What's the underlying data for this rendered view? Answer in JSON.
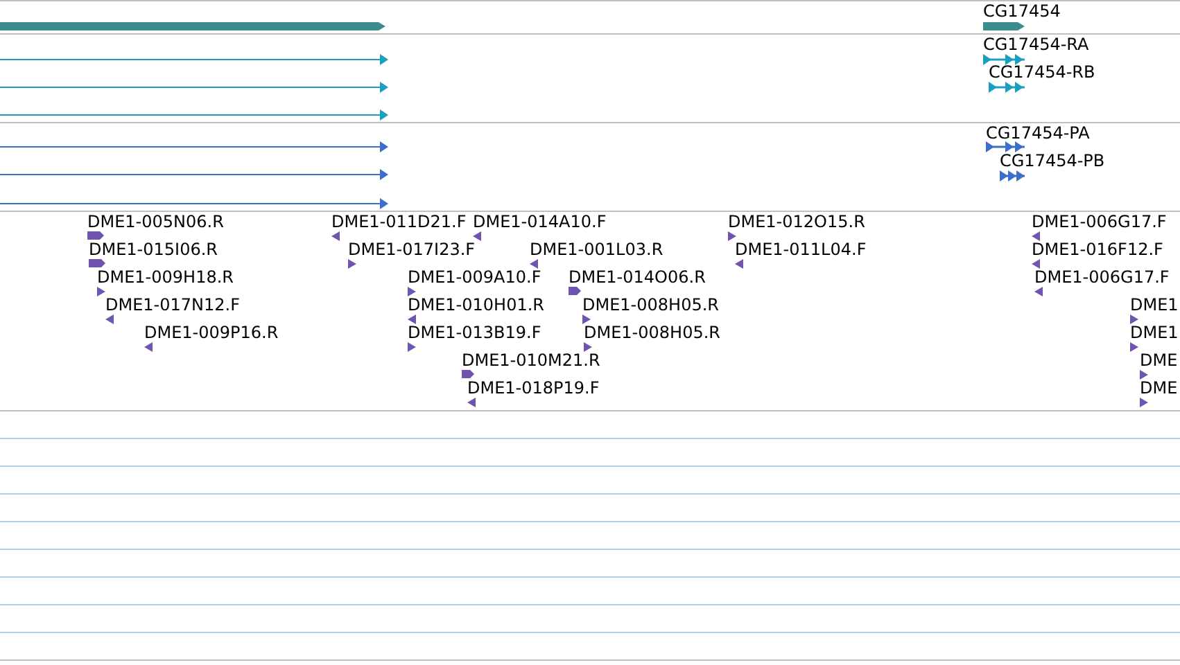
{
  "tracks": [
    {
      "kind": "gene",
      "features": [
        {
          "kind": "span"
        },
        {
          "kind": "model",
          "label": "CG17454"
        }
      ]
    },
    {
      "kind": "transcript",
      "features": [
        {
          "kind": "span"
        },
        {
          "kind": "span"
        },
        {
          "kind": "span"
        },
        {
          "kind": "model",
          "label": "CG17454-RA"
        },
        {
          "kind": "model",
          "label": "CG17454-RB"
        }
      ]
    },
    {
      "kind": "protein",
      "features": [
        {
          "kind": "span"
        },
        {
          "kind": "span"
        },
        {
          "kind": "span"
        },
        {
          "kind": "model",
          "label": "CG17454-PA"
        },
        {
          "kind": "model",
          "label": "CG17454-PB"
        }
      ]
    },
    {
      "kind": "est",
      "features": [
        {
          "label": "DME1-005N06.R",
          "reverse": false
        },
        {
          "label": "DME1-015I06.R",
          "reverse": false
        },
        {
          "label": "DME1-009H18.R",
          "reverse": false
        },
        {
          "label": "DME1-017N12.F",
          "reverse": true
        },
        {
          "label": "DME1-009P16.R",
          "reverse": true
        },
        {
          "label": "DME1-011D21.F",
          "reverse": true
        },
        {
          "label": "DME1-014A10.F",
          "reverse": true
        },
        {
          "label": "DME1-017I23.F",
          "reverse": false
        },
        {
          "label": "DME1-001L03.R",
          "reverse": true
        },
        {
          "label": "DME1-009A10.F",
          "reverse": false
        },
        {
          "label": "DME1-014O06.R",
          "reverse": false
        },
        {
          "label": "DME1-010H01.R",
          "reverse": true
        },
        {
          "label": "DME1-008H05.R",
          "reverse": false
        },
        {
          "label": "DME1-013B19.F",
          "reverse": false
        },
        {
          "label": "DME1-008H05.R",
          "reverse": false
        },
        {
          "label": "DME1-010M21.R",
          "reverse": false
        },
        {
          "label": "DME1-018P19.F",
          "reverse": true
        },
        {
          "label": "DME1-012O15.R",
          "reverse": false
        },
        {
          "label": "DME1-011L04.F",
          "reverse": true
        },
        {
          "label": "DME1-006G17.F",
          "reverse": true
        },
        {
          "label": "DME1-016F12.F",
          "reverse": true
        },
        {
          "label": "DME1-006G17.F",
          "reverse": true
        },
        {
          "label": "DME1",
          "reverse": false
        },
        {
          "label": "DME1",
          "reverse": false
        },
        {
          "label": "DME",
          "reverse": false
        },
        {
          "label": "DME",
          "reverse": false
        }
      ]
    }
  ]
}
